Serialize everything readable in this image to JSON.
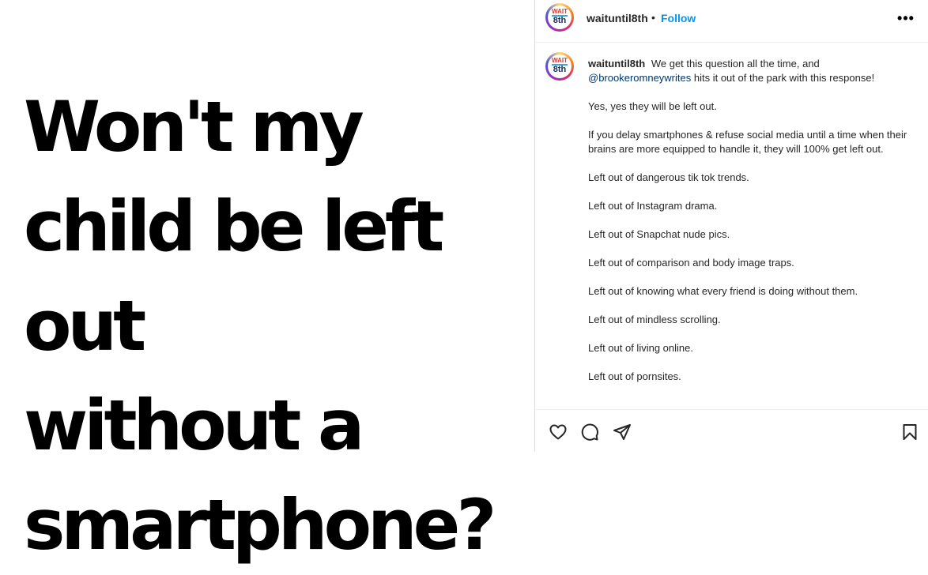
{
  "post_image": {
    "headline": "Won't my\nchild be left out\nwithout a\nsmartphone?"
  },
  "header": {
    "username": "waituntil8th",
    "separator": "•",
    "follow_label": "Follow",
    "more_icon": "more-horizontal-icon",
    "more_label": "•••"
  },
  "avatar": {
    "logo_top": "WAIT",
    "logo_bottom": "8th"
  },
  "caption": {
    "username": "waituntil8th",
    "intro_text": "We get this question all the time, and",
    "mention": "@brookeromneywrites",
    "intro_tail": "hits it out of the park with this response!",
    "paragraphs": [
      "Yes, yes they will be left out.",
      "If you delay smartphones & refuse social media until a time when their brains are more equipped to handle it, they will 100% get left out.",
      "Left out of dangerous tik tok trends.",
      "Left out of Instagram drama.",
      "Left out of Snapchat nude pics.",
      "Left out of comparison and body image traps.",
      "Left out of knowing what every friend is doing without them.",
      "Left out of mindless scrolling.",
      "Left out of living online.",
      "Left out of pornsites."
    ]
  },
  "actions": {
    "like_icon": "heart-icon",
    "comment_icon": "comment-icon",
    "share_icon": "share-icon",
    "save_icon": "bookmark-icon"
  }
}
